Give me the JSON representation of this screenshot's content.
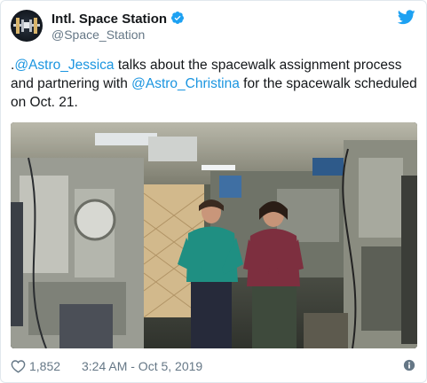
{
  "tweet": {
    "author_name": "Intl. Space Station",
    "author_handle": "@Space_Station",
    "text_prefix": ".",
    "mention_1": "@Astro_Jessica",
    "text_middle": " talks about the spacewalk assignment process and partnering with ",
    "mention_2": "@Astro_Christina",
    "text_suffix": " for the spacewalk scheduled on Oct. 21.",
    "like_count": "1,852",
    "timestamp": "3:24 AM - Oct 5, 2019"
  },
  "icons": {
    "avatar": "iss-logo-avatar",
    "verified": "verified-badge-icon",
    "brand": "twitter-bird-icon",
    "like": "heart-icon",
    "info": "info-icon"
  },
  "colors": {
    "link": "#1b95e0",
    "brand": "#1da1f2",
    "secondary_text": "#657786",
    "border": "#e1e8ed"
  }
}
